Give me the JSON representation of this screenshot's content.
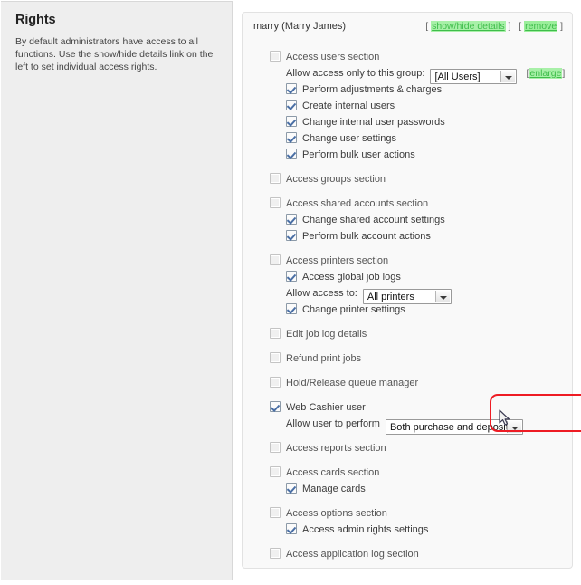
{
  "left_panel": {
    "title": "Rights",
    "description": "By default administrators have access to all functions. Use the show/hide details link on the left to set individual access rights."
  },
  "card": {
    "user_label": "marry (Marry James)",
    "links": {
      "open_bracket": "[",
      "show_hide_details": "show/hide details",
      "close_bracket": "]",
      "open_bracket2": "[",
      "remove": "remove",
      "close_bracket2": "]"
    }
  },
  "colors": {
    "link_green": "#3fbd4b",
    "highlight_red": "#ee1c24",
    "panel_bg": "#eeeeee",
    "card_bg": "#f9f9f9",
    "check_blue": "#4a6fa5"
  },
  "rights": [
    {
      "id": "access-users-section",
      "label": "Access users section",
      "level": 0,
      "checked": false,
      "gap": false
    },
    {
      "id": "allow-access-group",
      "label": "Allow access only to this group:",
      "level": 1,
      "type": "select-row",
      "select": {
        "value": "[All Users]",
        "options": [
          "[All Users]"
        ]
      },
      "extra_link": {
        "open": "[",
        "text": "enlarge",
        "close": "]"
      }
    },
    {
      "id": "perform-adjustments-charges",
      "label": "Perform adjustments & charges",
      "level": 1,
      "checked": true
    },
    {
      "id": "create-internal-users",
      "label": "Create internal users",
      "level": 1,
      "checked": true
    },
    {
      "id": "change-internal-user-passwords",
      "label": "Change internal user passwords",
      "level": 1,
      "checked": true
    },
    {
      "id": "change-user-settings",
      "label": "Change user settings",
      "level": 1,
      "checked": true
    },
    {
      "id": "perform-bulk-user-actions",
      "label": "Perform bulk user actions",
      "level": 1,
      "checked": true
    },
    {
      "id": "access-groups-section",
      "label": "Access groups section",
      "level": 0,
      "checked": false,
      "gap": true
    },
    {
      "id": "access-shared-accounts-section",
      "label": "Access shared accounts section",
      "level": 0,
      "checked": false,
      "gap": true
    },
    {
      "id": "change-shared-account-settings",
      "label": "Change shared account settings",
      "level": 1,
      "checked": true
    },
    {
      "id": "perform-bulk-account-actions",
      "label": "Perform bulk account actions",
      "level": 1,
      "checked": true
    },
    {
      "id": "access-printers-section",
      "label": "Access printers section",
      "level": 0,
      "checked": false,
      "gap": true
    },
    {
      "id": "access-global-job-logs",
      "label": "Access global job logs",
      "level": 1,
      "checked": true
    },
    {
      "id": "allow-access-to-printers",
      "label": "Allow access to:",
      "level": 1,
      "type": "select-row",
      "select": {
        "value": "All printers",
        "options": [
          "All printers"
        ]
      }
    },
    {
      "id": "change-printer-settings",
      "label": "Change printer settings",
      "level": 1,
      "checked": true
    },
    {
      "id": "edit-job-log-details",
      "label": "Edit job log details",
      "level": 0,
      "checked": false,
      "gap": true
    },
    {
      "id": "refund-print-jobs",
      "label": "Refund print jobs",
      "level": 0,
      "checked": false,
      "gap": true
    },
    {
      "id": "hold-release-queue-manager",
      "label": "Hold/Release queue manager",
      "level": 0,
      "checked": false,
      "gap": true
    },
    {
      "id": "web-cashier-user",
      "label": "Web Cashier user",
      "level": 0,
      "checked": true,
      "gap": true,
      "highlighted": true
    },
    {
      "id": "allow-user-to-perform",
      "label": "Allow user to perform",
      "level": 1,
      "type": "select-row",
      "highlighted": true,
      "select": {
        "value": "Both purchase and deposit",
        "options": [
          "Both purchase and deposit"
        ]
      }
    },
    {
      "id": "access-reports-section",
      "label": "Access reports section",
      "level": 0,
      "checked": false,
      "gap": true
    },
    {
      "id": "access-cards-section",
      "label": "Access cards section",
      "level": 0,
      "checked": false,
      "gap": true
    },
    {
      "id": "manage-cards",
      "label": "Manage cards",
      "level": 1,
      "checked": true
    },
    {
      "id": "access-options-section",
      "label": "Access options section",
      "level": 0,
      "checked": false,
      "gap": true
    },
    {
      "id": "access-admin-rights-settings",
      "label": "Access admin rights settings",
      "level": 1,
      "checked": true
    },
    {
      "id": "access-application-log-section",
      "label": "Access application log section",
      "level": 0,
      "checked": false,
      "gap": true
    }
  ]
}
